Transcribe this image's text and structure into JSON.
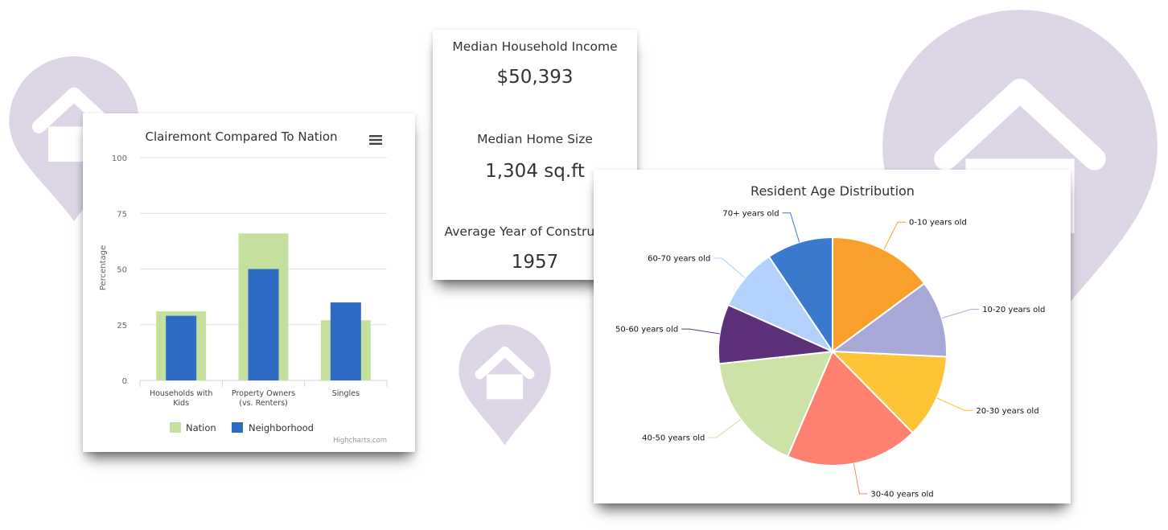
{
  "chart_data": [
    {
      "type": "bar",
      "title": "Clairemont Compared To Nation",
      "xlabel": "",
      "ylabel": "Percentage",
      "ylim": [
        0,
        100
      ],
      "yticks": [
        "0",
        "25",
        "50",
        "75",
        "100"
      ],
      "categories": [
        "Households with Kids",
        "Property Owners (vs. Renters)",
        "Singles"
      ],
      "category_label_lines": [
        [
          "Households with",
          "Kids"
        ],
        [
          "Property Owners",
          "(vs. Renters)"
        ],
        [
          "Singles"
        ]
      ],
      "series": [
        {
          "name": "Nation",
          "color": "#c5e09e",
          "values": [
            31,
            66,
            27
          ]
        },
        {
          "name": "Neighborhood",
          "color": "#2e6bc4",
          "values": [
            29,
            50,
            35
          ]
        }
      ],
      "legend": "bottom-center",
      "grid": true,
      "credits": "Highcharts.com"
    },
    {
      "type": "pie",
      "title": "Resident Age Distribution",
      "slices": [
        {
          "label": "0-10 years old",
          "value": 15,
          "color": "#f8a02b"
        },
        {
          "label": "10-20 years old",
          "value": 11,
          "color": "#a8a8d8"
        },
        {
          "label": "20-30 years old",
          "value": 12,
          "color": "#fec336"
        },
        {
          "label": "30-40 years old",
          "value": 19,
          "color": "#fe8070"
        },
        {
          "label": "40-50 years old",
          "value": 17,
          "color": "#cce2a6"
        },
        {
          "label": "50-60 years old",
          "value": 8.5,
          "color": "#5c3179"
        },
        {
          "label": "60-70 years old",
          "value": 9,
          "color": "#b2d1fc"
        },
        {
          "label": "70+ years old",
          "value": 9.5,
          "color": "#3a7acc"
        }
      ]
    }
  ],
  "stats": [
    {
      "label": "Median Household Income",
      "value": "$50,393"
    },
    {
      "label": "Median Home Size",
      "value": "1,304 sq.ft"
    },
    {
      "label": "Average Year of Construction",
      "value": "1957"
    }
  ],
  "colors": {
    "pin": "#ddd6e6",
    "house": "#ffffff"
  },
  "icons": [
    "home-location-pin-icon",
    "menu-icon"
  ]
}
